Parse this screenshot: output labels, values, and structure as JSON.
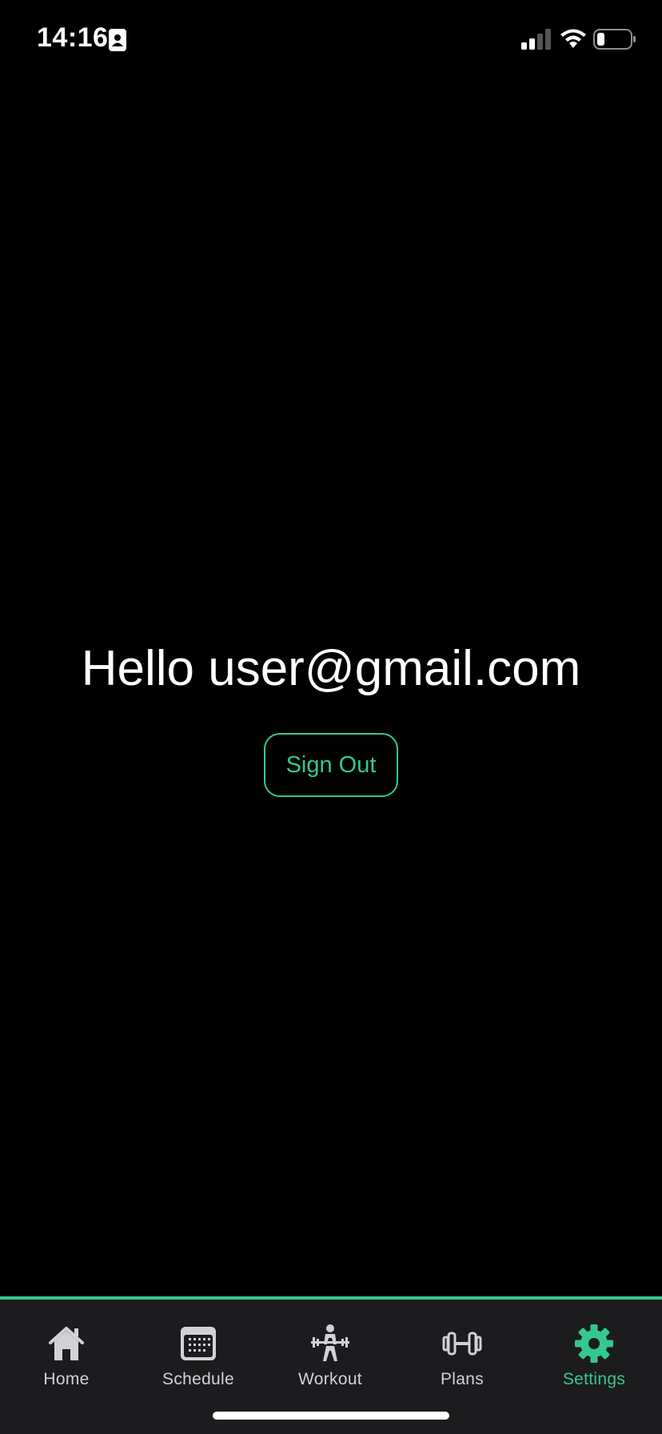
{
  "status_bar": {
    "time": "14:16",
    "icons": [
      "contact-card-icon",
      "signal-icon",
      "wifi-icon",
      "battery-icon"
    ],
    "battery_level": 0.2
  },
  "main": {
    "greeting": "Hello user@gmail.com",
    "signout_label": "Sign Out"
  },
  "tab_bar": {
    "active": "Settings",
    "tabs": [
      {
        "label": "Home",
        "icon": "house-icon"
      },
      {
        "label": "Schedule",
        "icon": "calendar-icon"
      },
      {
        "label": "Workout",
        "icon": "weightlifter-icon"
      },
      {
        "label": "Plans",
        "icon": "dumbbell-icon"
      },
      {
        "label": "Settings",
        "icon": "gear-icon"
      }
    ]
  },
  "colors": {
    "background": "#000000",
    "accent": "#33c98e",
    "tab_bar_bg": "#1c1c1e",
    "tab_inactive": "#d1d1d6"
  }
}
